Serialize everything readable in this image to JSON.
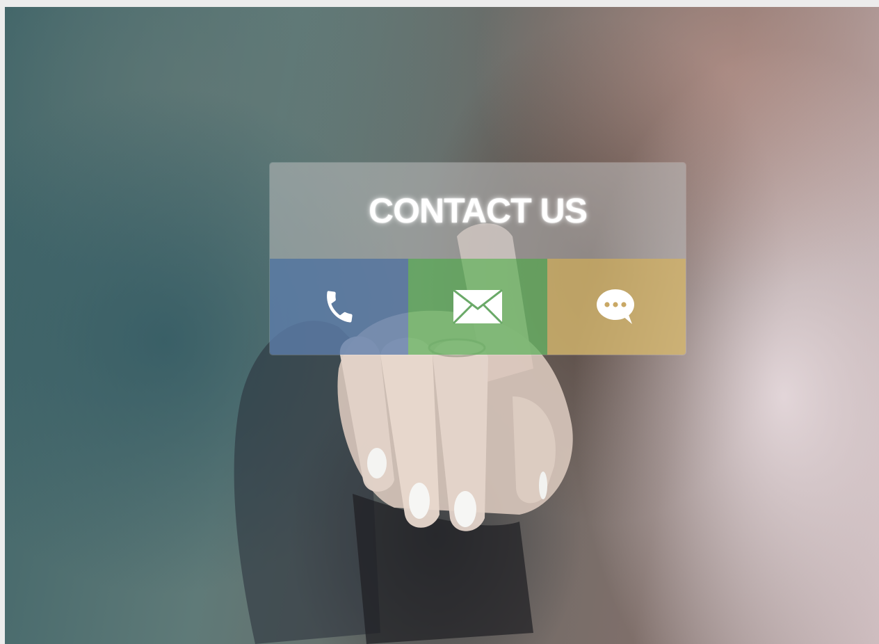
{
  "contact": {
    "title": "CONTACT US",
    "buttons": [
      {
        "icon": "phone-icon",
        "color": "#5e7eac"
      },
      {
        "icon": "envelope-icon",
        "color": "#68b464"
      },
      {
        "icon": "chat-bubble-icon",
        "color": "#d6b86e"
      }
    ]
  }
}
